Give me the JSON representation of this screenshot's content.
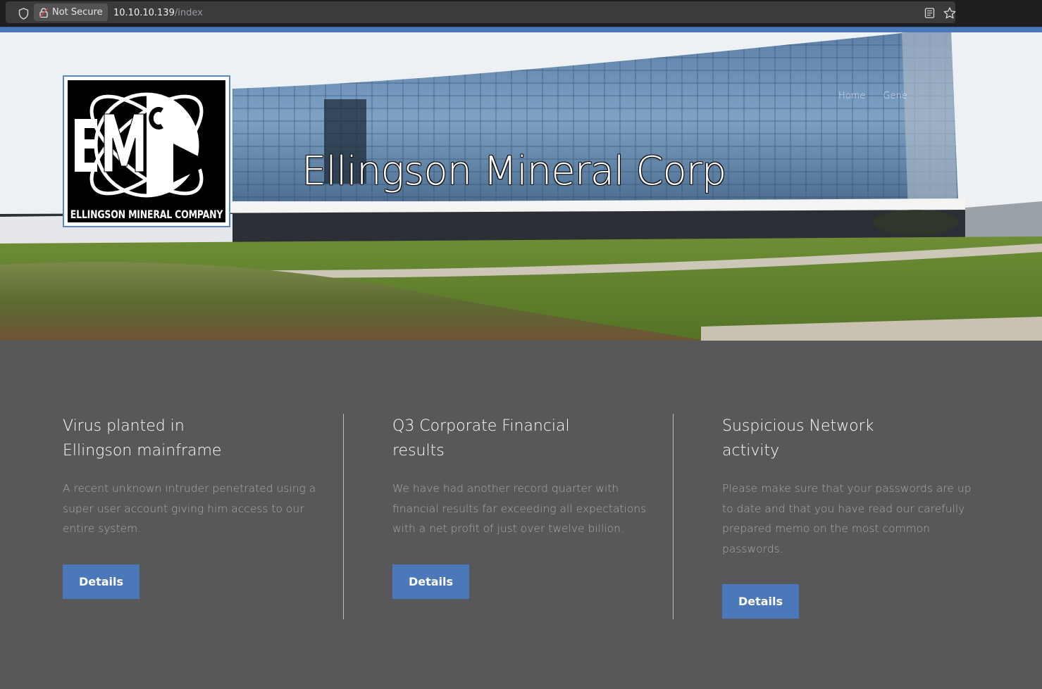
{
  "browser": {
    "security_label": "Not Secure",
    "url_host": "10.10.10.139",
    "url_path": "/index"
  },
  "hero": {
    "title": "Ellingson Mineral Corp",
    "logo_text": "ELLINGSON MINERAL COMPANY",
    "nav": [
      "Home",
      "Gene",
      ""
    ]
  },
  "articles": [
    {
      "title": "Virus planted in Ellingson mainframe",
      "body": "A recent unknown intruder penetrated using a super user account giving him access to our entire system.",
      "button": "Details"
    },
    {
      "title": "Q3 Corporate Financial results",
      "body": "We have had another record quarter with financial results far exceeding all expectations with a net profit of just over twelve billion.",
      "button": "Details"
    },
    {
      "title": "Suspicious Network activity",
      "body": "Please make sure that your passwords are up to date and that you have read our carefully prepared memo on the most common passwords.",
      "button": "Details"
    }
  ],
  "colors": {
    "accent": "#4a78b8",
    "background": "#58585a"
  }
}
